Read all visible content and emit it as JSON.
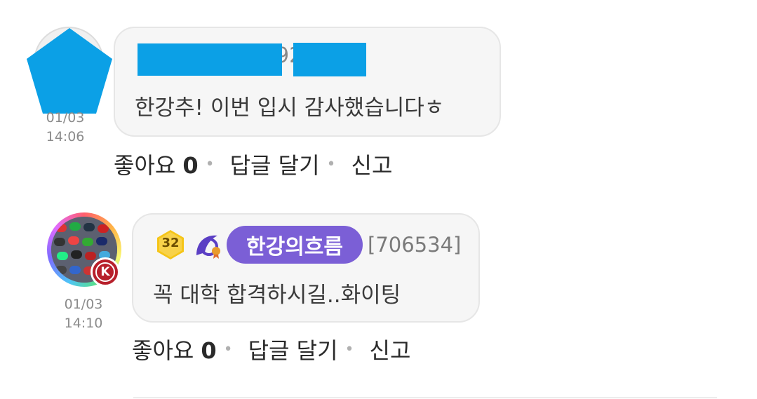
{
  "comments": [
    {
      "date": "01/03",
      "time": "14:06",
      "author_partial": "92",
      "text": "한강추! 이번 입시 감사했습니다ㅎ",
      "like_label": "좋아요",
      "like_count": "0",
      "reply_label": "답글 달기",
      "report_label": "신고",
      "redaction_color": "#0ba0e6"
    },
    {
      "date": "01/03",
      "time": "14:10",
      "level": "32",
      "author": "한강의흐름",
      "user_id": "[706534]",
      "avatar_badge": "K",
      "text": "꼭 대학 합격하시길..화이팅",
      "like_label": "좋아요",
      "like_count": "0",
      "reply_label": "답글 달기",
      "report_label": "신고",
      "name_pill_color": "#7b5fd6"
    }
  ]
}
